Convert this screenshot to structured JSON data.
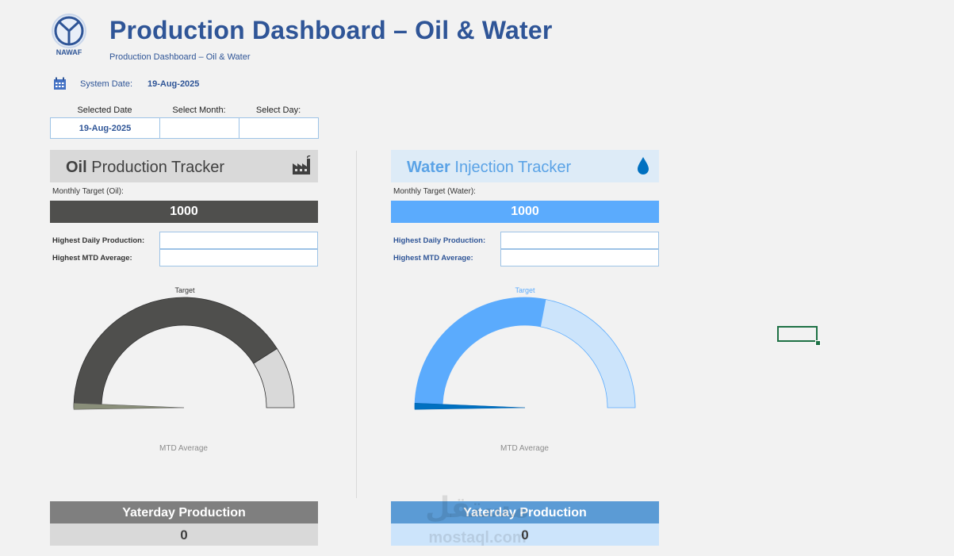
{
  "header": {
    "logo_text": "NAWAF",
    "title": "Production Dashboard – Oil & Water",
    "subtitle": "Production Dashboard – Oil & Water"
  },
  "system_date": {
    "label": "System Date:",
    "value": "19-Aug-2025",
    "icon": "calendar-icon"
  },
  "selectors": {
    "selected_date_label": "Selected Date",
    "selected_date_value": "19-Aug-2025",
    "select_month_label": "Select Month:",
    "select_month_value": "",
    "select_day_label": "Select Day:",
    "select_day_value": ""
  },
  "oil": {
    "title_bold": "Oil",
    "title_rest": " Production Tracker",
    "icon": "factory-icon",
    "target_label": "Monthly Target (Oil):",
    "target_value": "1000",
    "highest_daily_label": "Highest Daily Production:",
    "highest_daily_value": "",
    "highest_mtd_label": "Highest MTD Average:",
    "highest_mtd_value": "",
    "gauge_target_label": "Target",
    "gauge_mtd_label": "MTD Average",
    "gauge_target_fraction": 0.82,
    "gauge_actual_fraction": 0.0,
    "yesterday_label": "Yaterday Production",
    "yesterday_value": "0",
    "colors": {
      "primary": "#4f4f4d",
      "light": "#d9d9d9",
      "header": "#d9d9d9"
    }
  },
  "water": {
    "title_bold": "Water",
    "title_rest": " Injection Tracker",
    "icon": "water-drop-icon",
    "target_label": "Monthly Target (Water):",
    "target_value": "1000",
    "highest_daily_label": "Highest Daily Production:",
    "highest_daily_value": "",
    "highest_mtd_label": "Highest MTD Average:",
    "highest_mtd_value": "",
    "gauge_target_label": "Target",
    "gauge_mtd_label": "MTD Average",
    "gauge_target_fraction": 0.56,
    "gauge_actual_fraction": 0.0,
    "yesterday_label": "Yaterday Production",
    "yesterday_value": "0",
    "colors": {
      "primary": "#5babfd",
      "light": "#cce4fb",
      "header": "#ddebf7"
    }
  },
  "watermark": {
    "arabic": "مستقل",
    "latin": "mostaql.com"
  }
}
